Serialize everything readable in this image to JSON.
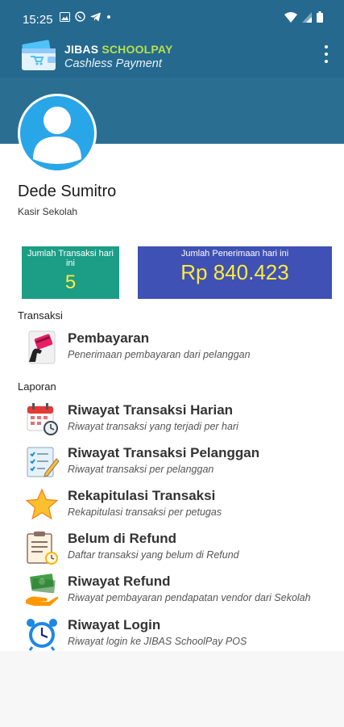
{
  "status_bar": {
    "time": "15:25"
  },
  "app": {
    "brand_part1": "JIBAS ",
    "brand_part2": "SCHOOLPAY",
    "tagline": "Cashless Payment"
  },
  "profile": {
    "name": "Dede Sumitro",
    "role": "Kasir Sekolah"
  },
  "stats": [
    {
      "label": "Jumlah Transaksi hari ini",
      "value": "5",
      "color": "#1b9e85"
    },
    {
      "label": "Jumlah Penerimaan hari ini",
      "value": "Rp 840.423",
      "color": "#3f51b5"
    }
  ],
  "sections": {
    "transaksi": "Transaksi",
    "laporan": "Laporan"
  },
  "menu": [
    {
      "title": "Pembayaran",
      "desc": "Penerimaan pembayaran dari pelanggan",
      "icon": "card-payment-icon"
    },
    {
      "title": "Riwayat Transaksi Harian",
      "desc": "Riwayat transaksi yang terjadi per hari",
      "icon": "calendar-clock-icon"
    },
    {
      "title": "Riwayat Transaksi Pelanggan",
      "desc": "Riwayat transaksi per pelanggan",
      "icon": "checklist-pencil-icon"
    },
    {
      "title": "Rekapitulasi Transaksi",
      "desc": "Rekapitulasi transaksi per petugas",
      "icon": "star-icon"
    },
    {
      "title": "Belum di Refund",
      "desc": "Daftar transaksi yang belum di Refund",
      "icon": "clipboard-clock-icon"
    },
    {
      "title": "Riwayat Refund",
      "desc": "Riwayat pembayaran pendapatan vendor dari Sekolah",
      "icon": "money-hand-icon"
    },
    {
      "title": "Riwayat Login",
      "desc": "Riwayat login ke JIBAS SchoolPay POS",
      "icon": "alarm-clock-icon"
    }
  ],
  "colors": {
    "header": "#25698f",
    "accent": "#b6e04a",
    "avatar": "#29a6e8",
    "stat_value": "#ffeb3b"
  }
}
